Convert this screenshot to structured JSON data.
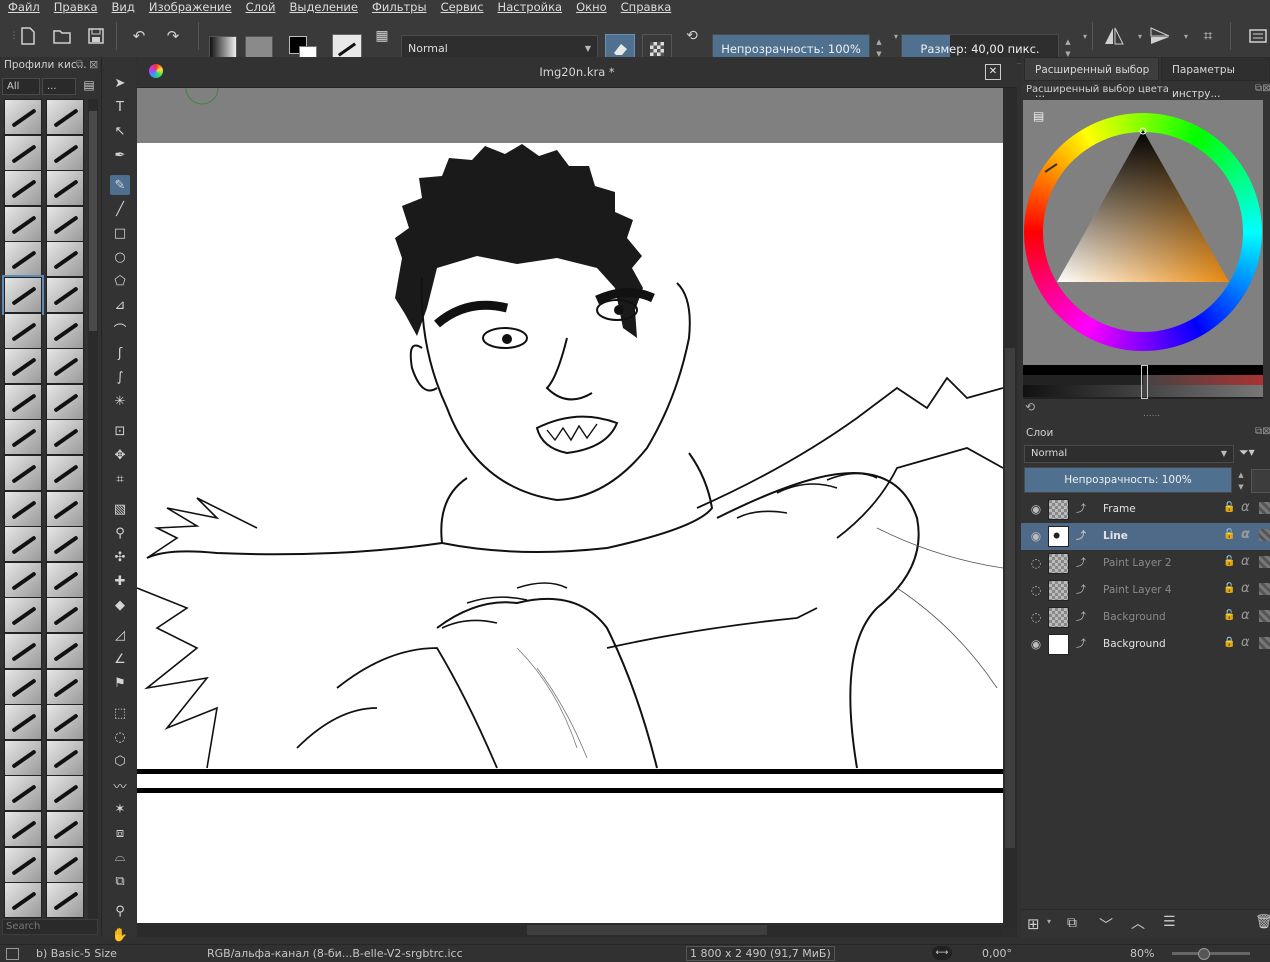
{
  "menu": [
    "Файл",
    "Правка",
    "Вид",
    "Изображение",
    "Слой",
    "Выделение",
    "Фильтры",
    "Сервис",
    "Настройка",
    "Окно",
    "Справка"
  ],
  "toolbar": {
    "blend_mode": "Normal",
    "opacity_label": "Непрозрачность: 100%",
    "opacity_fraction": 1.0,
    "size_label": "Размер: 40,00 пикс.",
    "size_fraction": 0.31
  },
  "presets_panel": {
    "title": "Профили кис...",
    "filter": "All",
    "tag": "...",
    "search_placeholder": "Search"
  },
  "document": {
    "title": "Img20n.kra *"
  },
  "color_panel": {
    "tab1": "Расширенный выбор ...",
    "tab2": "Параметры инстру...",
    "title": "Расширенный выбор цвета",
    "selected_color": "#e88a10"
  },
  "layers_panel": {
    "title": "Слои",
    "blend_mode": "Normal",
    "opacity_label": "Непрозрачность:  100%",
    "layers": [
      {
        "name": "Frame",
        "visible": true,
        "selected": false,
        "thumb": "checker",
        "locked": false
      },
      {
        "name": "Line",
        "visible": true,
        "selected": true,
        "thumb": "sketch",
        "locked": false
      },
      {
        "name": "Paint Layer 2",
        "visible": false,
        "selected": false,
        "thumb": "checker",
        "locked": false
      },
      {
        "name": "Paint Layer 4",
        "visible": false,
        "selected": false,
        "thumb": "checker",
        "locked": false
      },
      {
        "name": "Background",
        "visible": false,
        "selected": false,
        "thumb": "checker",
        "locked": false
      },
      {
        "name": "Background",
        "visible": true,
        "selected": false,
        "thumb": "white",
        "locked": true
      }
    ]
  },
  "status": {
    "brush": "b) Basic-5 Size",
    "colorspace": "RGB/альфа-канал (8-би...B-elle-V2-srgbtrc.icc",
    "dimensions": "1 800 x 2 490 (91,7 МиБ)",
    "rotation": "0,00°",
    "zoom": "80%"
  }
}
